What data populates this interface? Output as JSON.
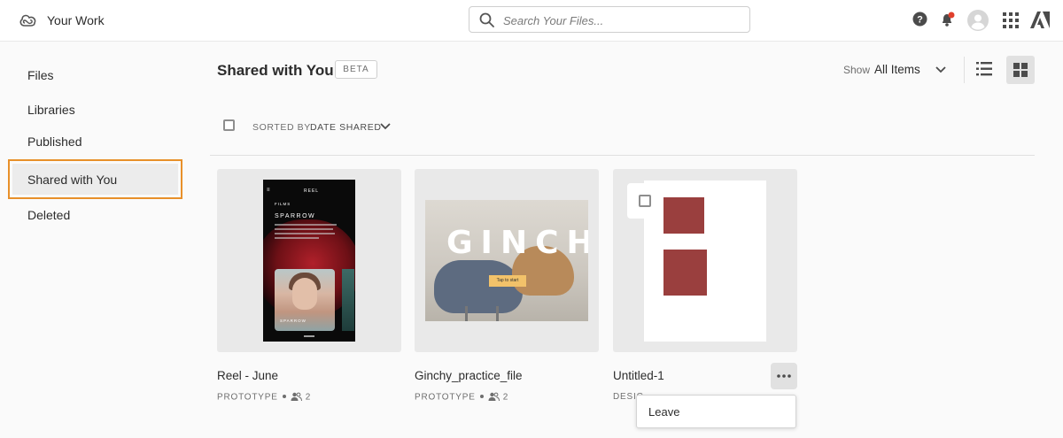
{
  "header": {
    "app_title": "Your Work",
    "search_placeholder": "Search Your Files..."
  },
  "sidebar": {
    "items": [
      {
        "label": "Files"
      },
      {
        "label": "Libraries"
      },
      {
        "label": "Published"
      },
      {
        "label": "Shared with You",
        "active": true
      },
      {
        "label": "Deleted"
      }
    ]
  },
  "main": {
    "title": "Shared with You",
    "badge": "BETA",
    "show_label": "Show",
    "show_value": "All Items",
    "sorted_by_label": "SORTED BY",
    "sort_value": "DATE SHARED"
  },
  "files": [
    {
      "title": "Reel - June",
      "type": "PROTOTYPE",
      "collaborators": "2"
    },
    {
      "title": "Ginchy_practice_file",
      "type": "PROTOTYPE",
      "collaborators": "2",
      "thumb_text": "GINCHY"
    },
    {
      "title": "Untitled-1",
      "type_partial": "DESIG"
    }
  ],
  "reel_thumb": {
    "app": "REEL",
    "section": "FILMS",
    "heading": "SPARROW",
    "caption": "SPARROW"
  },
  "ginchy_thumb": {
    "cta": "Tap to start"
  },
  "context_menu": {
    "items": [
      {
        "label": "Leave"
      }
    ]
  },
  "colors": {
    "accent_outline": "#e8902a",
    "notification": "#e0402c",
    "swatch": "#9a3f3e"
  }
}
